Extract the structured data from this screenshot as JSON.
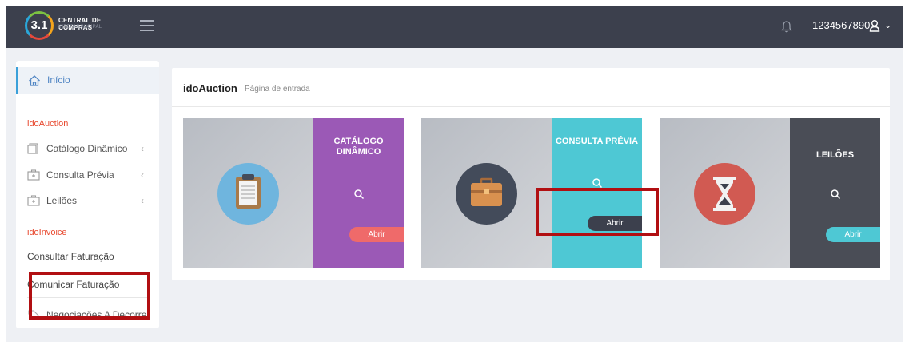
{
  "header": {
    "logo_number": "3.1",
    "logo_title": "CENTRAL DE COMPRAS",
    "logo_subtitle": "INTERMUNICIPAL",
    "username": "1234567890",
    "colors": {
      "bar": "#3c404d"
    }
  },
  "sidebar": {
    "home_label": "Início",
    "section_auction": "idoAuction",
    "items_auction": [
      {
        "label": "Catálogo Dinâmico",
        "icon": "catalog-icon"
      },
      {
        "label": "Consulta Prévia",
        "icon": "briefcase-icon"
      },
      {
        "label": "Leilões",
        "icon": "briefcase-icon"
      }
    ],
    "section_invoice": "idoInvoice",
    "items_invoice": [
      {
        "label": "Consultar Faturação"
      },
      {
        "label": "Comunicar Faturação"
      }
    ],
    "negotiations_label": "Negociações A Decorrer",
    "colors": {
      "section": "#e8492f",
      "active": "#3aa0d9"
    }
  },
  "main": {
    "title": "idoAuction",
    "subtitle": "Página de entrada",
    "cards": [
      {
        "label_line1": "CATÁLOGO",
        "label_line2": "DINÂMICO",
        "button": "Abrir",
        "icon": "clipboard-icon",
        "panel_color": "#9b59b6",
        "button_color": "#ef6a6a",
        "circle_color": "#6fb5de"
      },
      {
        "label_line1": "CONSULTA PRÉVIA",
        "label_line2": "",
        "button": "Abrir",
        "icon": "briefcase-icon",
        "panel_color": "#4ec8d4",
        "button_color": "#3c404d",
        "circle_color": "#434b5a"
      },
      {
        "label_line1": "LEILÕES",
        "label_line2": "",
        "button": "Abrir",
        "icon": "hourglass-icon",
        "panel_color": "#4a4d56",
        "button_color": "#4ec8d4",
        "circle_color": "#d15a52"
      }
    ]
  }
}
